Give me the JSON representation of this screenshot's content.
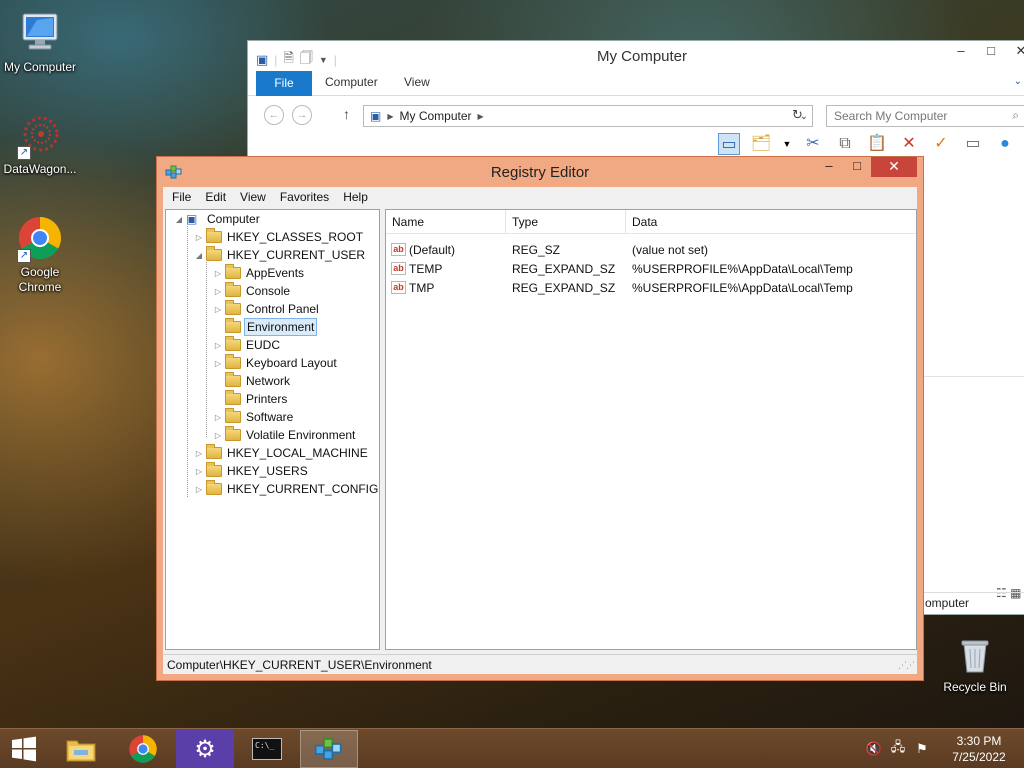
{
  "desktop": {
    "icons": [
      {
        "label": "My Computer",
        "icon": "computer-icon"
      },
      {
        "label": "DataWagon...",
        "icon": "datawagon-icon"
      },
      {
        "label": "Google Chrome",
        "icon": "chrome-icon"
      },
      {
        "label": "Recycle Bin",
        "icon": "recycle-bin-icon"
      }
    ]
  },
  "explorer": {
    "title": "My Computer",
    "tabs": [
      "File",
      "Computer",
      "View"
    ],
    "address": "My Computer",
    "search_placeholder": "Search My Computer",
    "status_text": "omputer",
    "controls": {
      "minimize": "–",
      "maximize": "□",
      "close": "✕"
    }
  },
  "regedit": {
    "title": "Registry Editor",
    "menu": [
      "File",
      "Edit",
      "View",
      "Favorites",
      "Help"
    ],
    "controls": {
      "minimize": "–",
      "maximize": "□",
      "close": "✕"
    },
    "tree": {
      "root": "Computer",
      "items": [
        {
          "label": "HKEY_CLASSES_ROOT",
          "level": 1,
          "expander": "▷"
        },
        {
          "label": "HKEY_CURRENT_USER",
          "level": 1,
          "expander": "◢"
        },
        {
          "label": "AppEvents",
          "level": 2,
          "expander": "▷"
        },
        {
          "label": "Console",
          "level": 2,
          "expander": "▷"
        },
        {
          "label": "Control Panel",
          "level": 2,
          "expander": "▷"
        },
        {
          "label": "Environment",
          "level": 2,
          "expander": "",
          "selected": true
        },
        {
          "label": "EUDC",
          "level": 2,
          "expander": "▷"
        },
        {
          "label": "Keyboard Layout",
          "level": 2,
          "expander": "▷"
        },
        {
          "label": "Network",
          "level": 2,
          "expander": ""
        },
        {
          "label": "Printers",
          "level": 2,
          "expander": ""
        },
        {
          "label": "Software",
          "level": 2,
          "expander": "▷"
        },
        {
          "label": "Volatile Environment",
          "level": 2,
          "expander": "▷"
        },
        {
          "label": "HKEY_LOCAL_MACHINE",
          "level": 1,
          "expander": "▷"
        },
        {
          "label": "HKEY_USERS",
          "level": 1,
          "expander": "▷"
        },
        {
          "label": "HKEY_CURRENT_CONFIG",
          "level": 1,
          "expander": "▷"
        }
      ]
    },
    "columns": [
      "Name",
      "Type",
      "Data"
    ],
    "values": [
      {
        "name": "(Default)",
        "type": "REG_SZ",
        "data": "(value not set)"
      },
      {
        "name": "TEMP",
        "type": "REG_EXPAND_SZ",
        "data": "%USERPROFILE%\\AppData\\Local\\Temp"
      },
      {
        "name": "TMP",
        "type": "REG_EXPAND_SZ",
        "data": "%USERPROFILE%\\AppData\\Local\\Temp"
      }
    ],
    "value_icon_text": "ab",
    "status_path": "Computer\\HKEY_CURRENT_USER\\Environment"
  },
  "taskbar": {
    "items": [
      {
        "name": "start-button",
        "icon": "windows-logo-icon"
      },
      {
        "name": "file-explorer",
        "icon": "folder-icon"
      },
      {
        "name": "chrome",
        "icon": "chrome-icon"
      },
      {
        "name": "settings",
        "icon": "gear-icon"
      },
      {
        "name": "command-prompt",
        "icon": "console-icon",
        "glyph": "C:\\_"
      },
      {
        "name": "registry-editor",
        "icon": "regedit-icon"
      }
    ],
    "tray": {
      "volume_icon": "volume-muted-icon",
      "network_icon": "network-icon",
      "flag_icon": "action-center-icon",
      "time": "3:30 PM",
      "date": "7/25/2022"
    }
  }
}
